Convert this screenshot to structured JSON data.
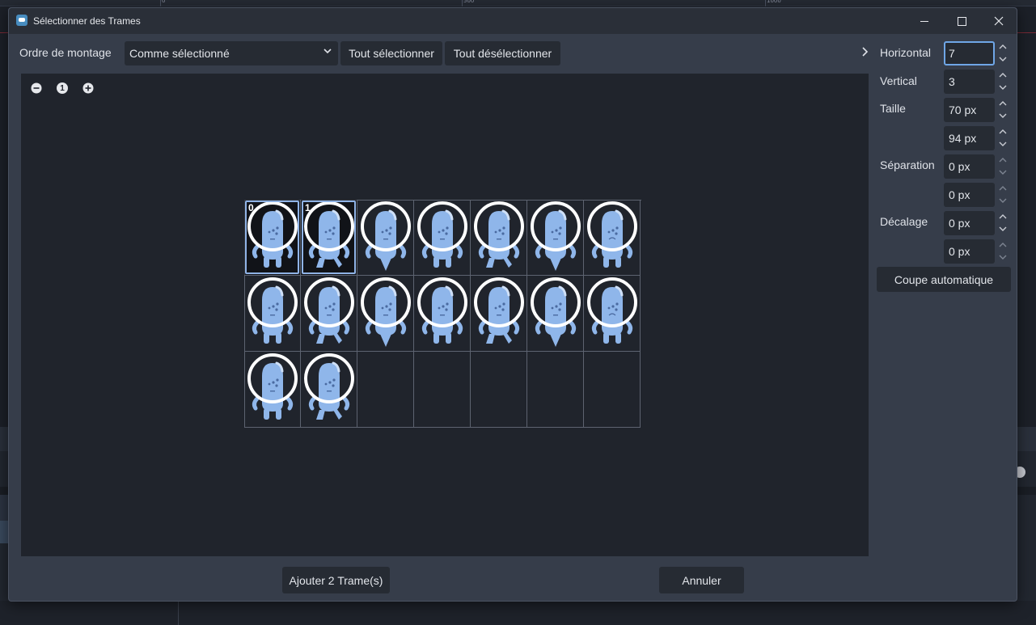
{
  "dialog": {
    "title": "Sélectionner des Trames",
    "app_icon": "godot-icon"
  },
  "toolbar": {
    "order_label": "Ordre de montage",
    "order_value": "Comme sélectionné",
    "select_all": "Tout sélectionner",
    "deselect_all": "Tout désélectionner"
  },
  "zoom": {
    "zoom_out_icon": "zoom-out-icon",
    "zoom_reset_icon": "zoom-reset-icon",
    "zoom_in_icon": "zoom-in-icon",
    "reset_label": "1"
  },
  "grid": {
    "columns": 7,
    "rows": 3,
    "frames_with_sprites": 16,
    "selected_frames": [
      {
        "index": 0,
        "label": "0"
      },
      {
        "index": 1,
        "label": "1"
      }
    ],
    "sprite_color": "#8fb6ea",
    "helmet_color": "#ffffff"
  },
  "settings": {
    "horizontal_label": "Horizontal",
    "horizontal_value": "7",
    "vertical_label": "Vertical",
    "vertical_value": "3",
    "size_label": "Taille",
    "size_x": "70 px",
    "size_y": "94 px",
    "separation_label": "Séparation",
    "separation_x": "0 px",
    "separation_y": "0 px",
    "offset_label": "Décalage",
    "offset_x": "0 px",
    "offset_y": "0 px",
    "auto_slice": "Coupe automatique"
  },
  "footer": {
    "add_button": "Ajouter 2 Trame(s)",
    "cancel_button": "Annuler"
  },
  "background": {
    "ruler_labels": [
      "0",
      "500",
      "1000"
    ]
  }
}
